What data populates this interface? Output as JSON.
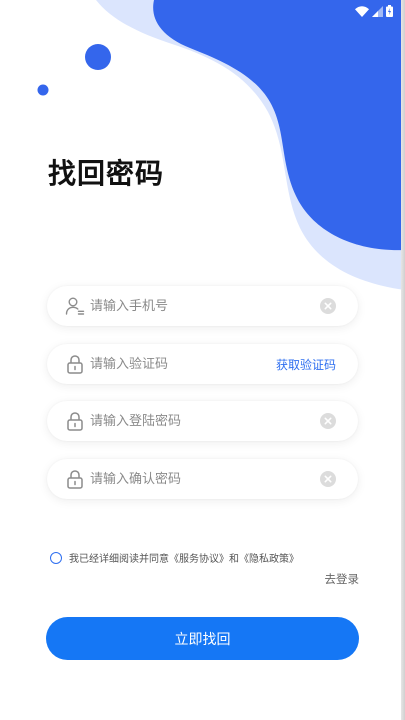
{
  "title": "找回密码",
  "colors": {
    "primary_blue": "#3466ec",
    "light_blue": "#dbe5fd",
    "button_blue": "#1577f5"
  },
  "status_bar": {
    "icons": [
      "wifi-icon",
      "signal-icon",
      "battery-icon"
    ]
  },
  "form": {
    "phone": {
      "placeholder": "请输入手机号",
      "icon": "user-icon",
      "trailing_icon": "clear-icon"
    },
    "code": {
      "placeholder": "请输入验证码",
      "icon": "lock-icon",
      "action_label": "获取验证码"
    },
    "password": {
      "placeholder": "请输入登陆密码",
      "icon": "lock-icon",
      "trailing_icon": "clear-icon"
    },
    "confirm": {
      "placeholder": "请输入确认密码",
      "icon": "lock-icon",
      "trailing_icon": "clear-icon"
    }
  },
  "agreement": {
    "prefix": "我已经详细阅读并同意",
    "service_link": "《服务协议》",
    "joiner": "和",
    "privacy_link": "《隐私政策》",
    "checked": false
  },
  "goto_login_label": "去登录",
  "submit_label": "立即找回"
}
